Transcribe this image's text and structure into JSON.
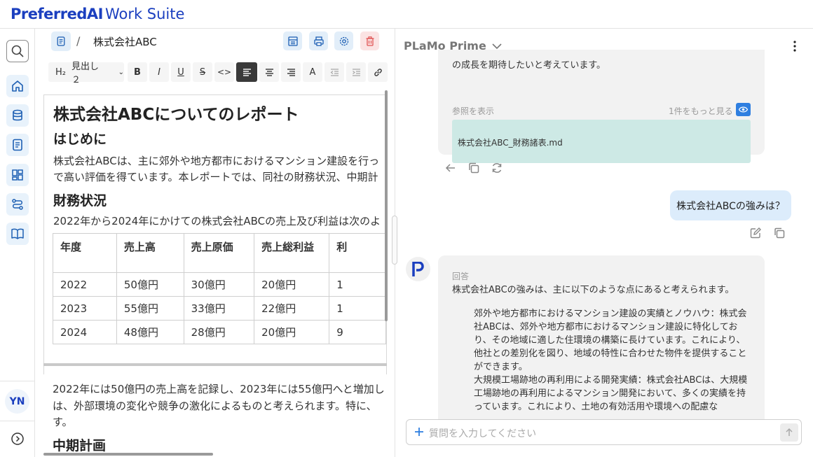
{
  "app": {
    "brand": "PreferredAI",
    "suite": "Work Suite"
  },
  "sidebar": {
    "items": [
      {
        "name": "search",
        "icon": "search-icon"
      },
      {
        "name": "home",
        "icon": "home-icon"
      },
      {
        "name": "database",
        "icon": "database-icon"
      },
      {
        "name": "documents",
        "icon": "document-icon"
      },
      {
        "name": "dashboard",
        "icon": "grid-icon"
      },
      {
        "name": "workflow",
        "icon": "workflow-icon"
      },
      {
        "name": "library",
        "icon": "book-icon"
      }
    ],
    "user_initials": "YN"
  },
  "editor": {
    "breadcrumb_sep": "/",
    "doc_title": "株式会社ABC",
    "toolbar": {
      "heading_icon": "H₂",
      "heading_select": "見出し２",
      "bold": "B",
      "italic": "I",
      "underline": "U",
      "strike": "S",
      "code": "<>",
      "font_color": "A"
    },
    "h1": "株式会社ABCについてのレポート",
    "sections": {
      "intro_heading": "はじめに",
      "intro_line1": "株式会社ABCは、主に郊外や地方都市におけるマンション建設を行っ",
      "intro_line2": "で高い評価を得ています。本レポートでは、同社の財務状況、中期計",
      "finance_heading": "財務状況",
      "finance_text": "2022年から2024年にかけての株式会社ABCの売上及び利益は次のよ",
      "after_line1": "2022年には50億円の売上高を記録し、2023年には55億円へと増加し",
      "after_line2": "は、外部環境の変化や競争の激化によるものと考えられます。特に、",
      "after_line3": "す。",
      "plan_heading": "中期計画"
    },
    "table": {
      "headers": [
        "年度",
        "売上高",
        "売上原価",
        "売上総利益",
        "利"
      ],
      "rows": [
        [
          "2022",
          "50億円",
          "30億円",
          "20億円",
          "1"
        ],
        [
          "2023",
          "55億円",
          "33億円",
          "22億円",
          "1"
        ],
        [
          "2024",
          "48億円",
          "28億円",
          "20億円",
          "9"
        ]
      ]
    }
  },
  "chat": {
    "model": "PLaMo Prime",
    "prev_answer_tail": "の成長を期待したいと考えています。",
    "references_label": "参照を表示",
    "more_refs": "1件をもっと見る",
    "ref_file": "株式会社ABC_財務諸表.md",
    "user_question": "株式会社ABCの強みは？",
    "answer_label": "回答",
    "answer_intro": "株式会社ABCの強みは、主に以下のような点にあると考えられます。",
    "answer_points": [
      "郊外や地方都市におけるマンション建設の実績とノウハウ：株式会社ABCは、郊外や地方都市におけるマンション建設に特化しており、その地域に適した住環境の構築に長けています。これにより、他社との差別化を図り、地域の特性に合わせた物件を提供することができます。",
      "大規模工場跡地の再利用による開発実績：株式会社ABCは、大規模工場跡地の再利用によるマンション開発において、多くの実績を持っています。これにより、土地の有効活用や環境への配慮な"
    ],
    "input_placeholder": "質問を入力してください"
  }
}
